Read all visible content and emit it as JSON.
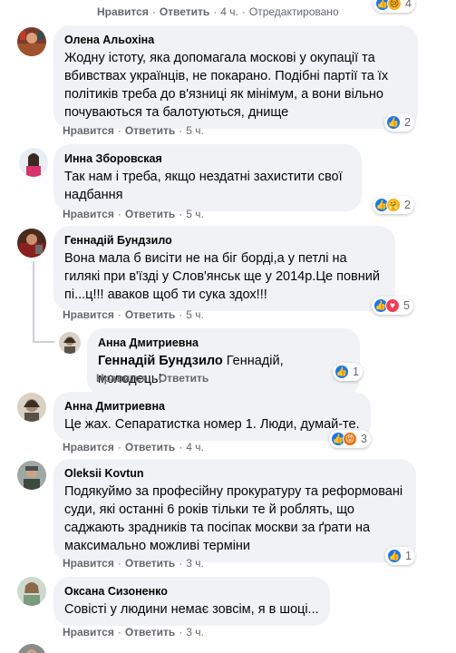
{
  "common": {
    "like": "Нравится",
    "reply": "Ответить",
    "dot": "·"
  },
  "top": {
    "time": "4 ч.",
    "edited": "Отредактировано",
    "reactions_count": "4"
  },
  "comments": [
    {
      "author": "Олена Альохіна",
      "text": "Жодну істоту, яка допомагала москові у окупації та вбивствах українців, не покарано. Подібні партії та їх політиків треба до в'язниці як мінімум, а вони вільно почуваються та балотуються, днище",
      "time": "5 ч.",
      "reactions_count": "2"
    },
    {
      "author": "Инна Зборовская",
      "text": "Так нам і треба, якщо нездатні захистити свої надбання",
      "time": "5 ч.",
      "reactions_count": "2"
    },
    {
      "author": "Геннадій Бундзило",
      "text": "Вона мала б висіти не на біг борді,а у петлі на гилякі при в'їзді у Слов'янськ ще у 2014р.Це повний пі...ц!!! аваков щоб ти сука здох!!!",
      "time": "5 ч.",
      "reactions_count": "5"
    },
    {
      "author": "Анна Дмитриевна",
      "mention": "Геннадій Бундзило",
      "text": " Геннадій, молодець!",
      "time": "",
      "reactions_count": "1"
    },
    {
      "author": "Анна Дмитриевна",
      "text": "Це жах. Сепаратистка номер 1. Люди, думай-те.",
      "time": "4 ч.",
      "reactions_count": "3"
    },
    {
      "author": "Oleksii Kovtun",
      "text": "Подякуймо за професійну прокуратуру та реформовані суди, які останні 6 років тільки те й роблять, що саджають зрадників та посіпак москви за ґрати на максимально можливі терміни",
      "time": "3 ч.",
      "reactions_count": "1"
    },
    {
      "author": "Оксана Сизоненко",
      "text": "Совісті у людини немає зовсім, я в шоці...",
      "time": "3 ч.",
      "reactions_count": ""
    }
  ],
  "colors": {
    "like": "#1877f2",
    "bubble": "#f0f2f5",
    "meta": "#65676b"
  }
}
